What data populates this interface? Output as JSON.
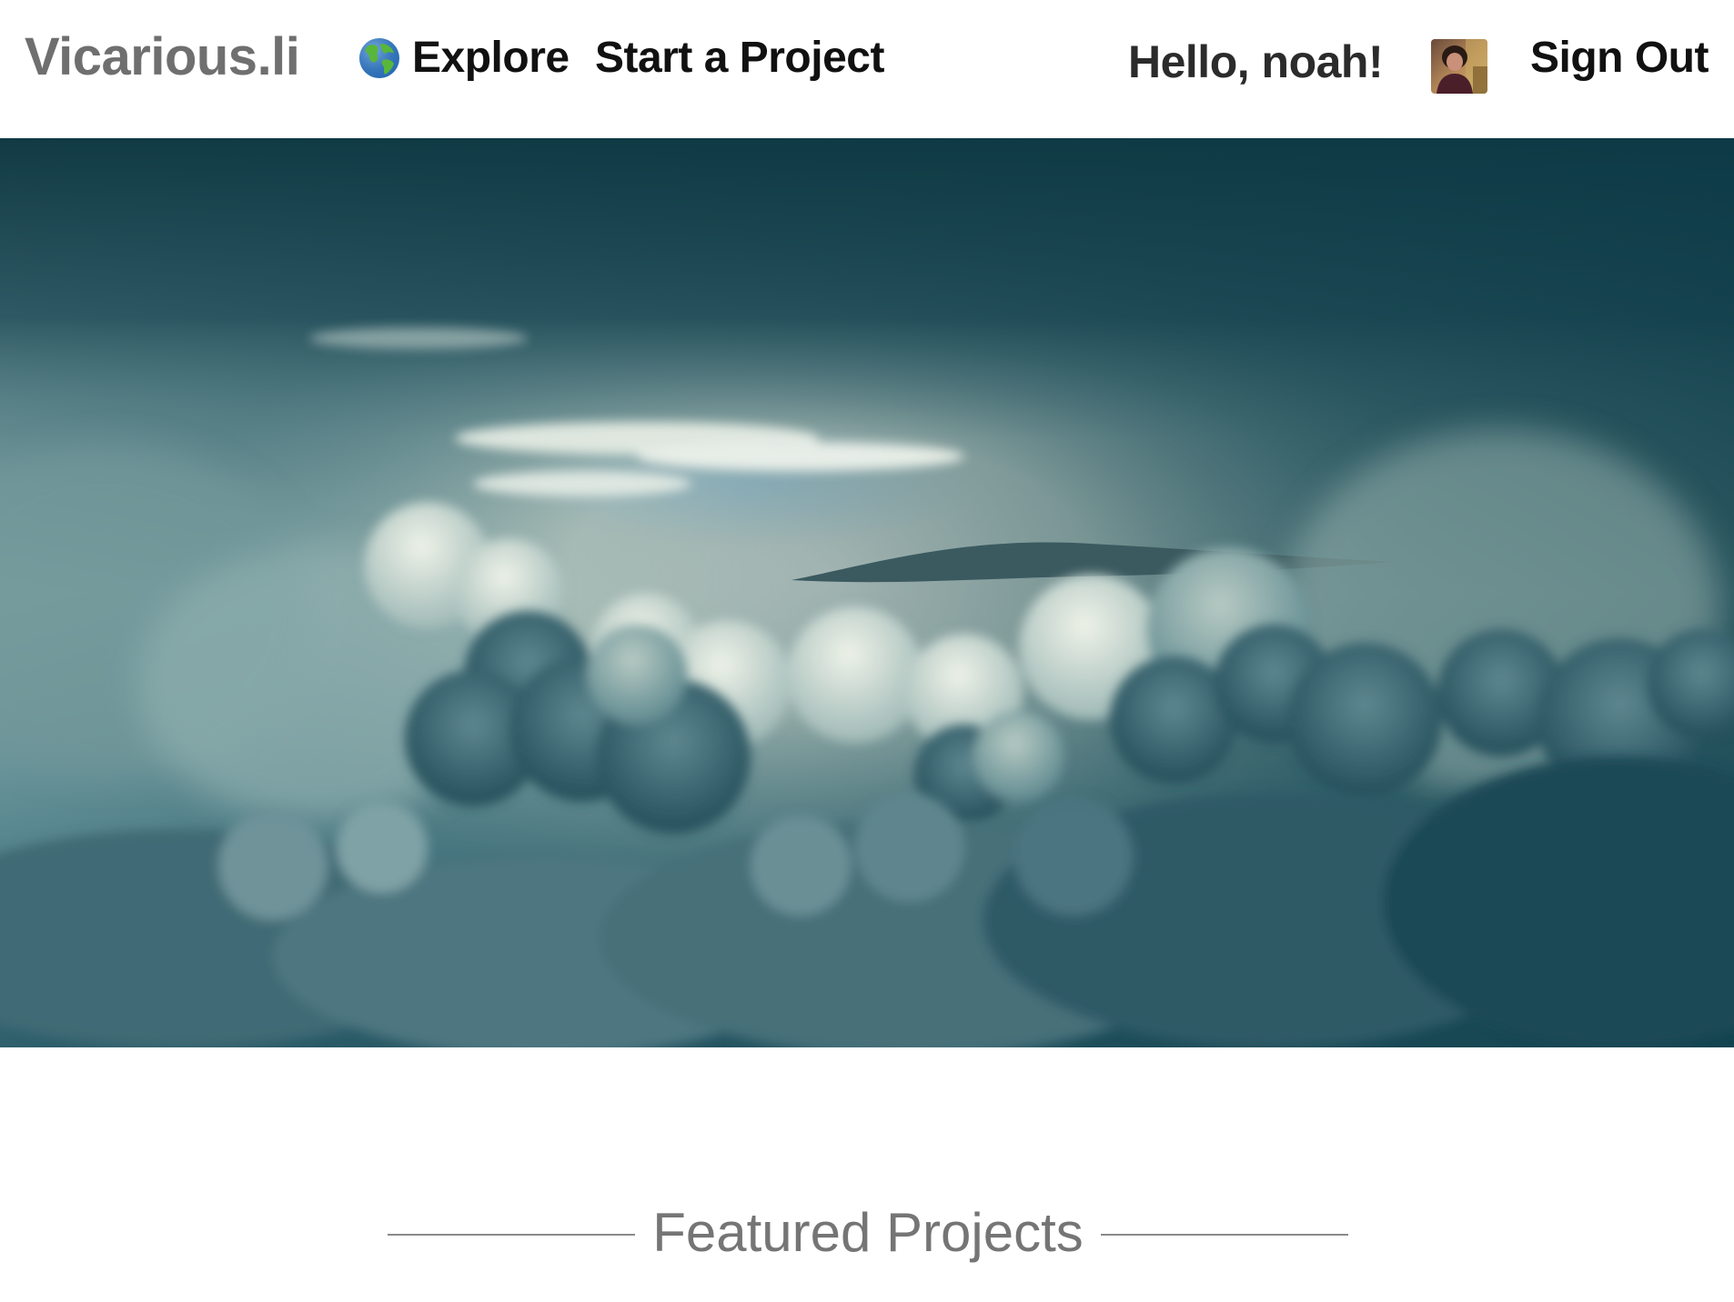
{
  "nav": {
    "brand": "Vicarious.li",
    "explore_label": "Explore",
    "explore_icon": "globe-icon",
    "start_project_label": "Start a Project",
    "greeting": "Hello, noah!",
    "avatar_icon": "user-avatar",
    "sign_out_label": "Sign Out"
  },
  "main": {
    "section_title": "Featured Projects"
  },
  "colors": {
    "brand": "#6f6f6f",
    "nav_text": "#111111",
    "section_title": "#757575",
    "sky_dark": "#0b3a46",
    "sky_light": "#e8efe2"
  }
}
